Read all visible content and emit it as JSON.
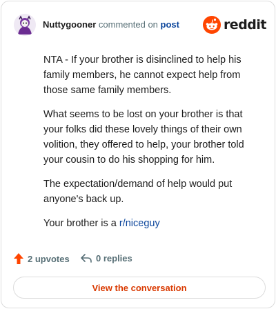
{
  "header": {
    "username": "Nuttygooner",
    "action_text": "commented on",
    "post_link": "post",
    "logo_text": "reddit"
  },
  "comment": {
    "paragraphs": [
      "NTA - If your brother is disinclined to help his family members, he cannot expect help from those same family members.",
      "What seems to be lost on your brother is that your folks did these lovely things of their own volition, they offered to help, your brother told your cousin to do his shopping for him.",
      "The expectation/demand of help would put anyone's back up."
    ],
    "last_prefix": "Your brother is a ",
    "subreddit_link": "r/niceguy"
  },
  "footer": {
    "upvotes": "2 upvotes",
    "replies": "0 replies"
  },
  "cta": {
    "label": "View the conversation"
  },
  "colors": {
    "upvote": "#ff4500",
    "link": "#0a449b",
    "cta_text": "#d93900"
  }
}
